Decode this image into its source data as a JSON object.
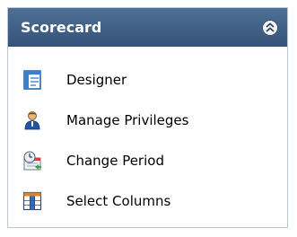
{
  "panel": {
    "title": "Scorecard",
    "collapse_icon": "chevron-double-up-icon",
    "items": [
      {
        "label": "Designer",
        "icon": "designer-icon"
      },
      {
        "label": "Manage Privileges",
        "icon": "user-icon"
      },
      {
        "label": "Change Period",
        "icon": "change-period-icon"
      },
      {
        "label": "Select Columns",
        "icon": "select-columns-icon"
      }
    ]
  },
  "colors": {
    "header_top": "#4f6f94",
    "header_bottom": "#355379",
    "border": "#b9c6d3"
  }
}
